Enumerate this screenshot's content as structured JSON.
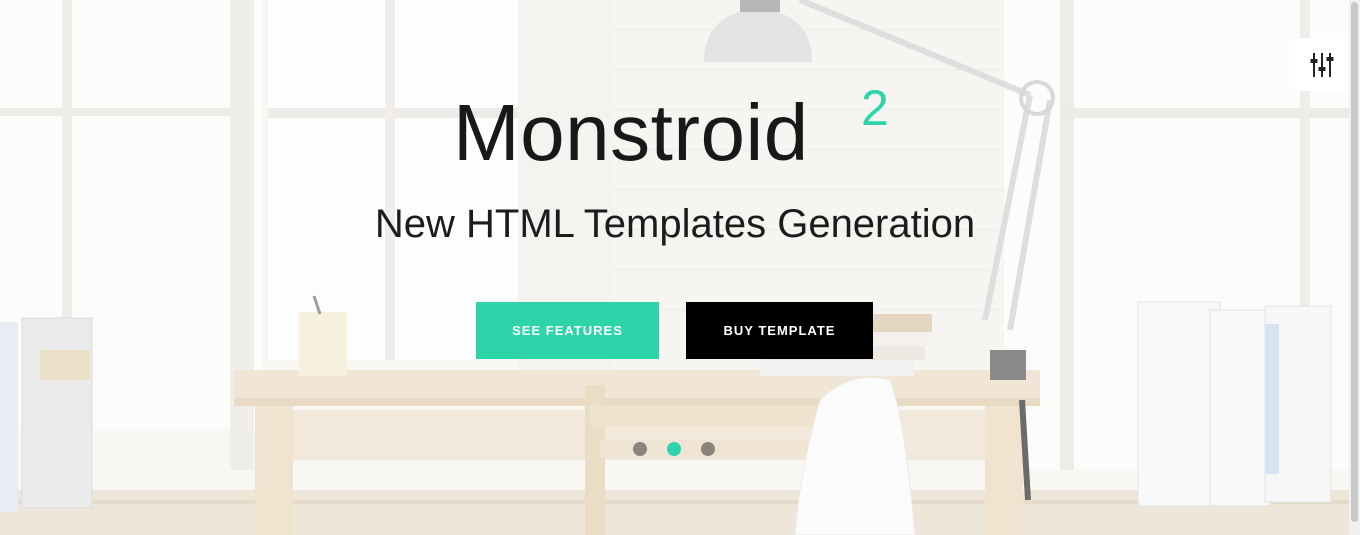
{
  "hero": {
    "title": "Monstroid",
    "title_superscript": "2",
    "subtitle": "New HTML Templates Generation",
    "buttons": {
      "see_features": "SEE FEATURES",
      "buy_template": "BUY TEMPLATE"
    },
    "slider": {
      "slide_count": 3,
      "active_index": 1
    }
  },
  "settings": {
    "icon": "sliders-icon"
  },
  "colors": {
    "accent": "#2dd4aa",
    "dark_button": "#000000",
    "title_text": "#181818"
  }
}
